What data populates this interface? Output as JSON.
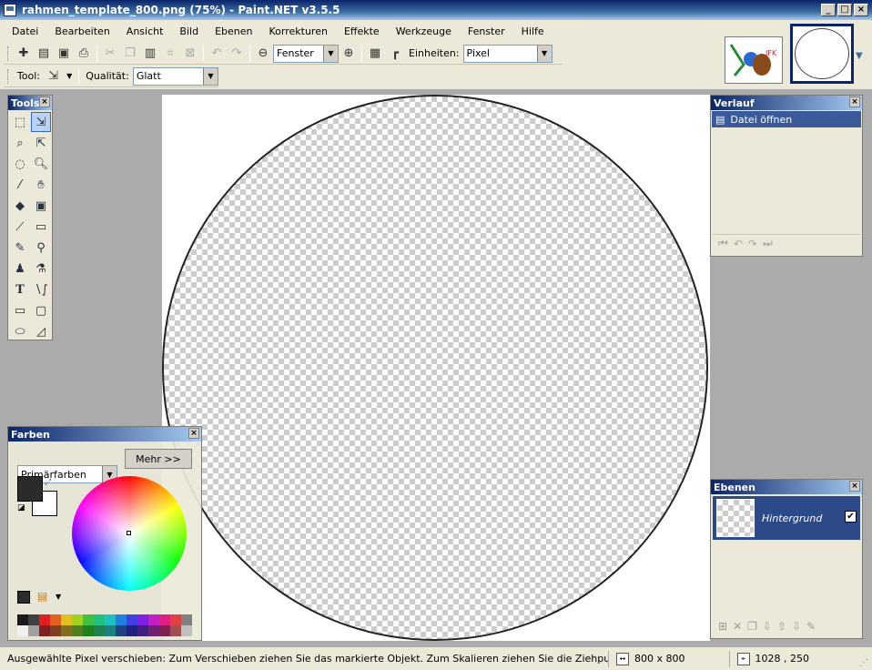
{
  "window": {
    "title": "rahmen_template_800.png (75%) - Paint.NET v3.5.5"
  },
  "menu": [
    "Datei",
    "Bearbeiten",
    "Ansicht",
    "Bild",
    "Ebenen",
    "Korrekturen",
    "Effekte",
    "Werkzeuge",
    "Fenster",
    "Hilfe"
  ],
  "toolbar": {
    "zoom_value": "Fenster",
    "units_label": "Einheiten:",
    "units_value": "Pixel",
    "tool_label": "Tool:",
    "quality_label": "Qualität:",
    "quality_value": "Glatt"
  },
  "tools_panel": {
    "title": "Tools"
  },
  "history_panel": {
    "title": "Verlauf",
    "items": [
      "Datei öffnen"
    ]
  },
  "layers_panel": {
    "title": "Ebenen",
    "layers": [
      {
        "name": "Hintergrund",
        "visible": true
      }
    ]
  },
  "colors_panel": {
    "title": "Farben",
    "mode_value": "Primärfarben",
    "more_label": "Mehr >>",
    "primary": "#2b2b2b",
    "secondary": "#ffffff"
  },
  "palette": [
    "#1a1a1a",
    "#404040",
    "#e02020",
    "#e06020",
    "#e0c020",
    "#a0d020",
    "#40c040",
    "#20c080",
    "#20c0c0",
    "#2080e0",
    "#4040e0",
    "#8020e0",
    "#c020c0",
    "#e02080",
    "#e04040",
    "#808080",
    "#f0f0f0",
    "#a0a0a0",
    "#802020",
    "#804020",
    "#807020",
    "#508020",
    "#208020",
    "#208050",
    "#208080",
    "#204080",
    "#202080",
    "#402080",
    "#702070",
    "#802050",
    "#a05050",
    "#c0c0c0"
  ],
  "statusbar": {
    "message": "Ausgewählte Pixel verschieben: Zum Verschieben ziehen Sie das markierte Objekt. Zum Skalieren ziehen Sie die Ziehpunkte. Zum Drehen c",
    "image_size": "800 x 800",
    "cursor_pos": "1028 , 250"
  }
}
